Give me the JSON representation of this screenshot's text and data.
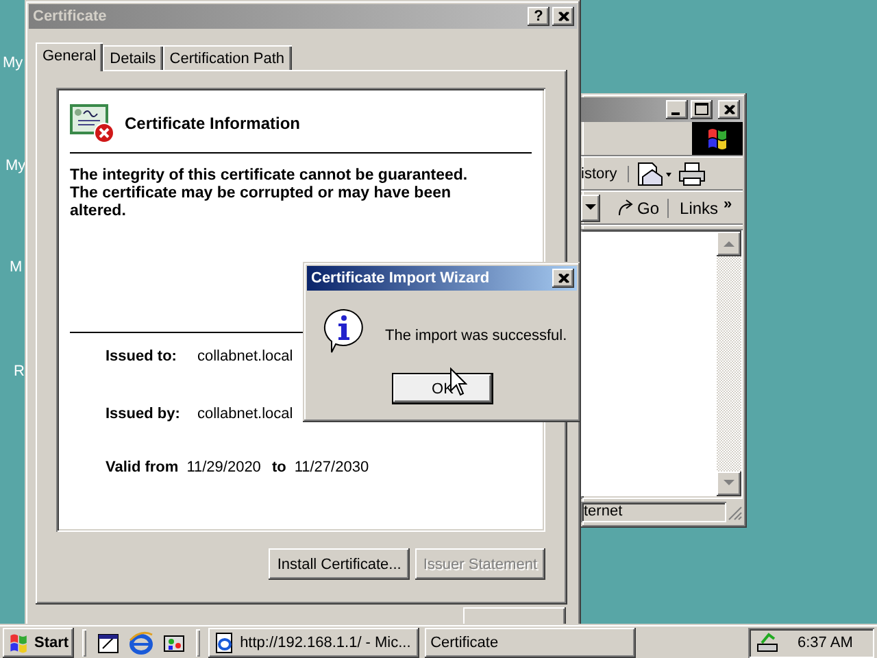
{
  "desktop": {
    "icon_labels": [
      "My",
      "My",
      "M",
      "R"
    ]
  },
  "certificate_window": {
    "title": "Certificate",
    "active": false,
    "help_button": "?",
    "tabs": [
      {
        "label": "General",
        "selected": true
      },
      {
        "label": "Details",
        "selected": false
      },
      {
        "label": "Certification Path",
        "selected": false
      }
    ],
    "header": "Certificate Information",
    "warning": "The integrity of this certificate cannot be guaranteed. The certificate may be corrupted or may have been altered.",
    "fields": [
      {
        "label": "Issued to:",
        "value": "collabnet.local"
      },
      {
        "label": "Issued by:",
        "value": "collabnet.local"
      }
    ],
    "validity": {
      "label": "Valid from",
      "from": "11/29/2020",
      "joiner": "to",
      "until": "11/27/2030"
    },
    "buttons": [
      {
        "label": "Install Certificate...",
        "disabled": false
      },
      {
        "label": "Issuer Statement",
        "disabled": true
      }
    ]
  },
  "browser_window": {
    "active": false,
    "history": "istory",
    "go": "Go",
    "links": "Links",
    "more": "»",
    "status": "ternet"
  },
  "wizard": {
    "title": "Certificate Import Wizard",
    "active": true,
    "message": "The import was successful.",
    "button": "OK"
  },
  "taskbar": {
    "start": "Start",
    "tasks": [
      {
        "label": "http://192.168.1.1/ - Mic...",
        "selected": false
      },
      {
        "label": "Certificate",
        "selected": false
      }
    ],
    "clock": "6:37 AM"
  }
}
